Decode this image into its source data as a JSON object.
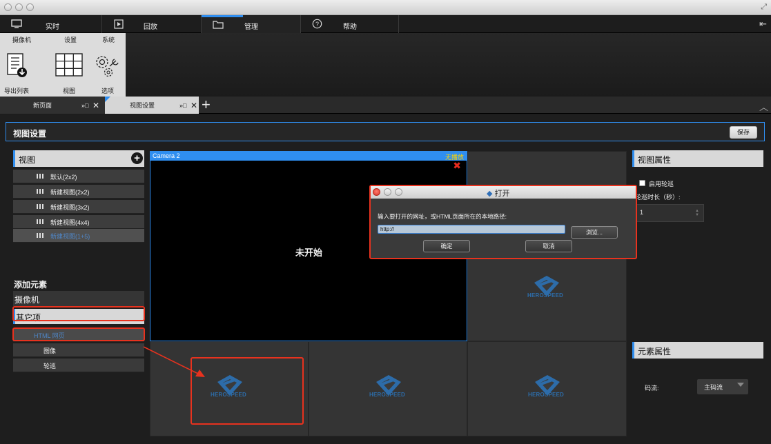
{
  "nav": {
    "tabs": [
      {
        "label": "实时"
      },
      {
        "label": "回放"
      },
      {
        "label": "管理"
      },
      {
        "label": "帮助"
      }
    ]
  },
  "ribbon": {
    "tabs": [
      "摄像机",
      "设置",
      "系统"
    ],
    "buttons": [
      {
        "label": "导出列表",
        "icon": "export-list-icon"
      },
      {
        "label": "视图",
        "icon": "view-grid-icon"
      },
      {
        "label": "选项",
        "icon": "options-gears-icon"
      }
    ]
  },
  "doc_tabs": [
    {
      "label": "新页面",
      "pin": "»□",
      "close": "✕"
    },
    {
      "label": "视图设置",
      "pin": "»□",
      "close": "✕"
    }
  ],
  "view_settings": {
    "title": "视图设置",
    "save_label": "保存"
  },
  "left_panel": {
    "views_title": "视图",
    "views": [
      "默认(2x2)",
      "新建视图(2x2)",
      "新建视图(3x2)",
      "新建视图(4x4)",
      "新建视图(1+5)"
    ],
    "add_element_label": "添加元素",
    "categories": [
      "摄像机",
      "其它项"
    ],
    "elements": [
      "HTML 网页",
      "图像",
      "轮巡"
    ]
  },
  "grid": {
    "camera_name": "Camera 2",
    "camera_status": "无播放",
    "not_started": "未开始",
    "brand": "HEROSPEED"
  },
  "right_panel": {
    "view_props_title": "视图属性",
    "enable_tour_label": "启用轮巡",
    "tour_duration_label": "轮巡时长（秒）:",
    "tour_duration_value": "1",
    "element_props_title": "元素属性",
    "stream_label": "码流:",
    "stream_value": "主码流"
  },
  "dialog": {
    "title": "打开",
    "prompt": "输入要打开的网址，或HTML页面所在的本地路径:",
    "url_value": "http://",
    "browse_label": "浏览...",
    "ok_label": "确定",
    "cancel_label": "取消"
  },
  "colors": {
    "accent": "#2f8ef0",
    "highlight": "#e8321e",
    "status_yellow": "#ffd400"
  }
}
